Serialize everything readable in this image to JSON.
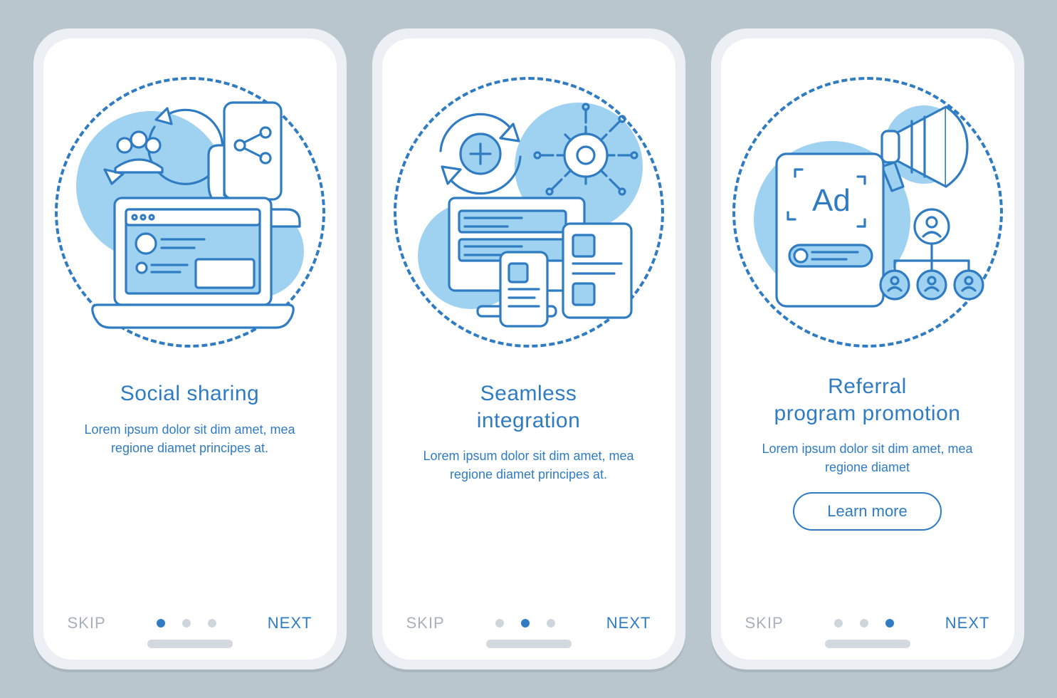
{
  "colors": {
    "primary": "#2f7cc2",
    "accent_light": "#9fd1f0",
    "muted": "#a8b0bb"
  },
  "screens": [
    {
      "title": "Social sharing",
      "body": "Lorem ipsum dolor sit dim amet, mea regione diamet principes at.",
      "skip": "SKIP",
      "next": "NEXT",
      "active_dot": 0,
      "cta": null,
      "icons": [
        "cycle-arrows-icon",
        "people-group-icon",
        "hand-phone-share-icon",
        "laptop-profile-icon"
      ]
    },
    {
      "title": "Seamless\nintegration",
      "body": "Lorem ipsum dolor sit dim amet, mea regione diamet principes at.",
      "skip": "SKIP",
      "next": "NEXT",
      "active_dot": 1,
      "cta": null,
      "icons": [
        "refresh-plus-icon",
        "gear-circuit-icon",
        "desktop-tablet-phone-icon"
      ]
    },
    {
      "title": "Referral\nprogram promotion",
      "body": "Lorem ipsum dolor sit dim amet, mea regione diamet",
      "skip": "SKIP",
      "next": "NEXT",
      "active_dot": 2,
      "cta": "Learn more",
      "ad_label": "Ad",
      "icons": [
        "megaphone-icon",
        "tablet-ad-icon",
        "referral-tree-icon"
      ]
    }
  ]
}
